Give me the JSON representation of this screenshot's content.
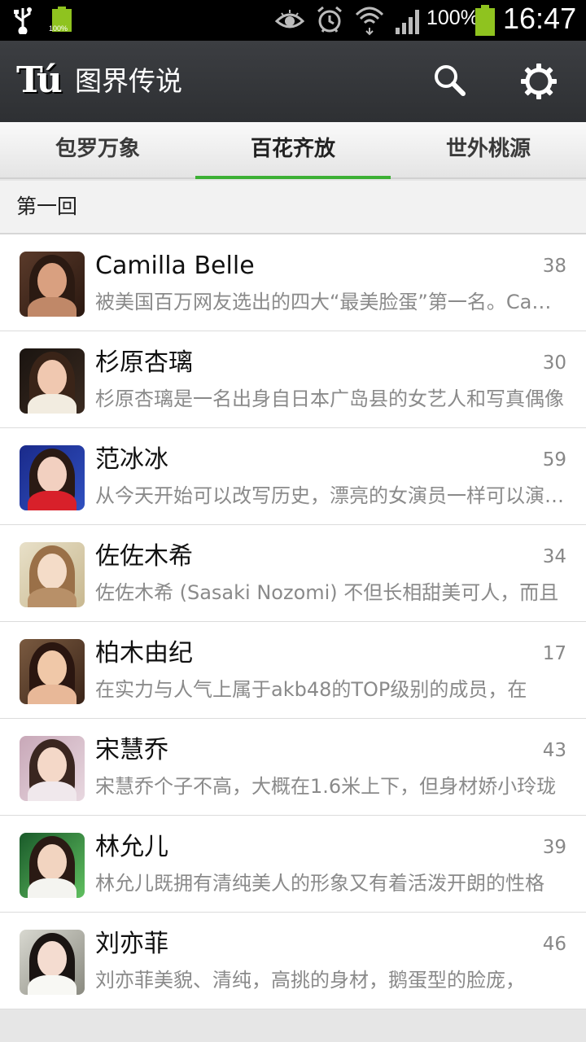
{
  "status_bar": {
    "battery_small_label": "100%",
    "battery_percent": "100%",
    "time": "16:47",
    "icons": [
      "usb-icon",
      "battery-icon",
      "eye-icon",
      "alarm-icon",
      "wifi-icon",
      "signal-icon",
      "battery-icon"
    ]
  },
  "action_bar": {
    "logo_text": "Tú",
    "title": "图界传说",
    "icons": [
      "search-icon",
      "settings-icon"
    ]
  },
  "tabs": [
    {
      "label": "包罗万象",
      "selected": false
    },
    {
      "label": "百花齐放",
      "selected": true
    },
    {
      "label": "世外桃源",
      "selected": false
    }
  ],
  "accent_color": "#3cb034",
  "section": {
    "title": "第一回"
  },
  "items": [
    {
      "name": "Camilla Belle",
      "count": "38",
      "desc": "被美国百万网友选出的四大“最美脸蛋”第一名。Camilla"
    },
    {
      "name": "杉原杏璃",
      "count": "30",
      "desc": "杉原杏璃是一名出身自日本广岛县的女艺人和写真偶像"
    },
    {
      "name": "范冰冰",
      "count": "59",
      "desc": "从今天开始可以改写历史，漂亮的女演员一样可以演好戏"
    },
    {
      "name": "佐佐木希",
      "count": "34",
      "desc": "佐佐木希 (Sasaki Nozomi) 不但长相甜美可人，而且"
    },
    {
      "name": "柏木由纪",
      "count": "17",
      "desc": "在实力与人气上属于akb48的TOP级别的成员，在"
    },
    {
      "name": "宋慧乔",
      "count": "43",
      "desc": "宋慧乔个子不高，大概在1.6米上下，但身材娇小玲珑"
    },
    {
      "name": "林允儿",
      "count": "39",
      "desc": "林允儿既拥有清纯美人的形象又有着活泼开朗的性格"
    },
    {
      "name": "刘亦菲",
      "count": "46",
      "desc": "刘亦菲美貌、清纯，高挑的身材，鹅蛋型的脸庞，"
    }
  ]
}
